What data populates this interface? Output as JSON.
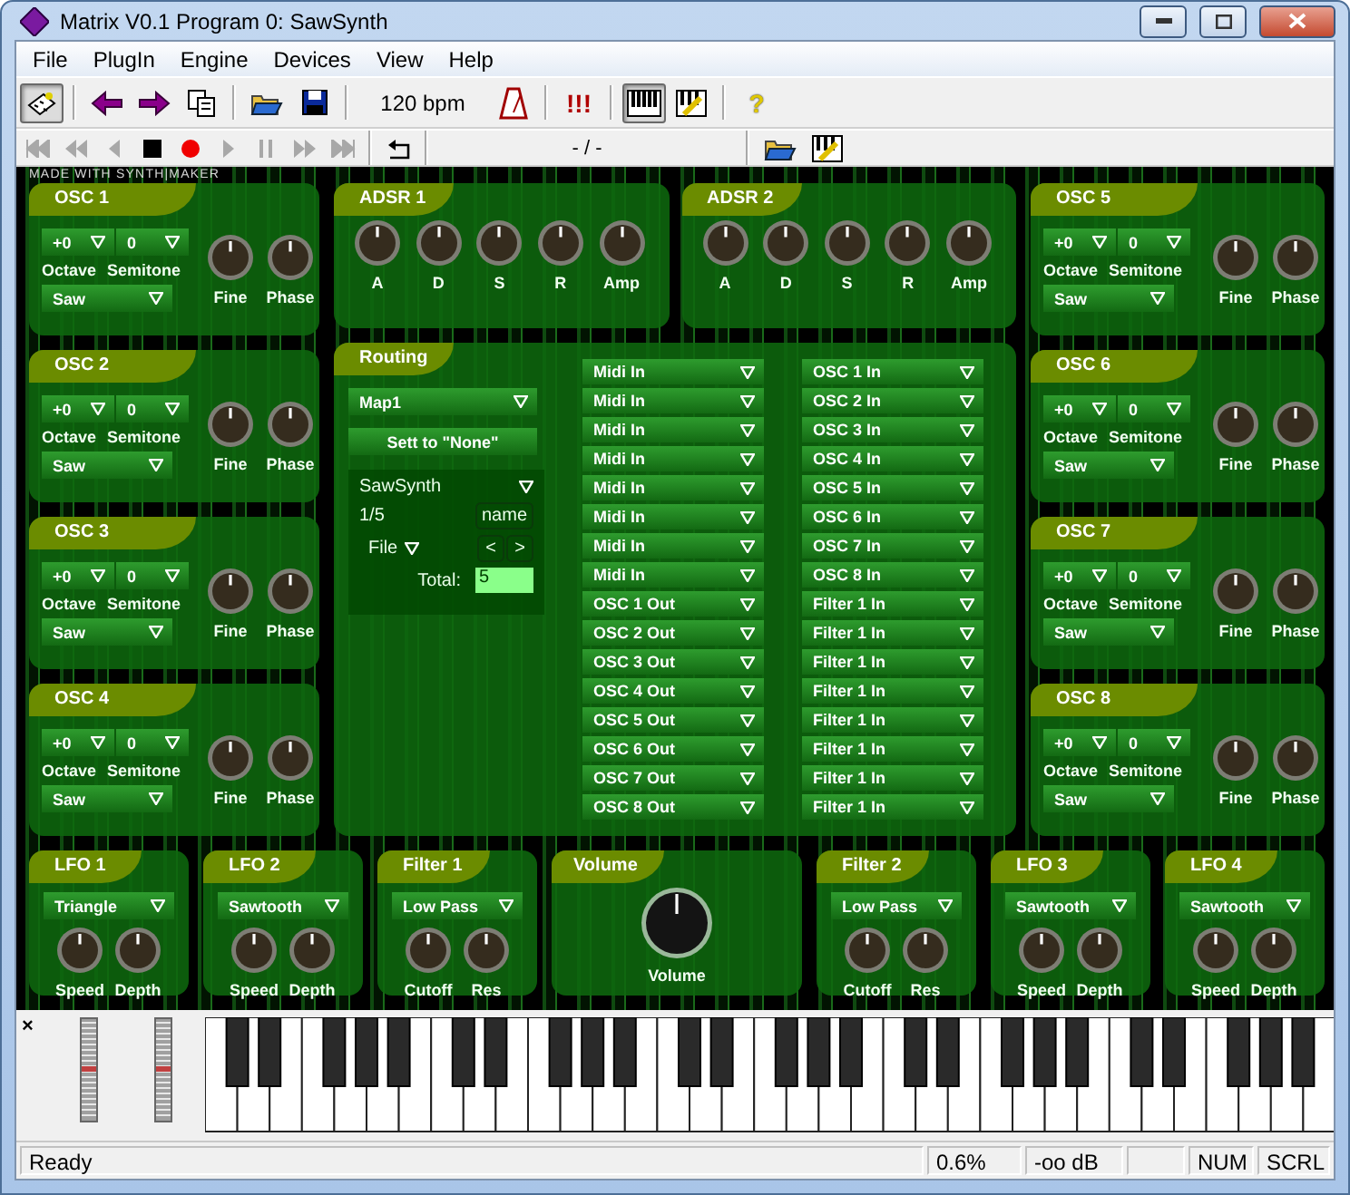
{
  "window": {
    "title": "Matrix V0.1 Program 0: SawSynth"
  },
  "menu": [
    "File",
    "PlugIn",
    "Engine",
    "Devices",
    "View",
    "Help"
  ],
  "toolbar": {
    "tempo": "120 bpm",
    "buttons": [
      {
        "pressed": true
      },
      {
        "pressed": false
      },
      {
        "pressed": false
      },
      {
        "pressed": false
      },
      {
        "pressed": false
      },
      {
        "pressed": false
      },
      {
        "pressed": false
      },
      {
        "pressed": false,
        "label": "!!!"
      },
      {
        "pressed": true
      },
      {
        "pressed": false
      },
      {
        "pressed": false,
        "label": "?"
      }
    ]
  },
  "transport": {
    "position": "- / -",
    "buttons": [
      {
        "disabled": true
      },
      {
        "disabled": true
      },
      {
        "disabled": true
      },
      {
        "disabled": false
      },
      {
        "disabled": false
      },
      {
        "disabled": true
      },
      {
        "disabled": true
      },
      {
        "disabled": true
      },
      {
        "disabled": true
      },
      {
        "disabled": false
      }
    ]
  },
  "synth": {
    "credit": "MADE WITH SYNTH|MAKER",
    "left_oscs": [
      {
        "title": "OSC 1",
        "octave": "+0",
        "semitone": "0",
        "octave_label": "Octave",
        "semitone_label": "Semitone",
        "wave": "Saw",
        "knobs": [
          "Fine",
          "Phase"
        ]
      },
      {
        "title": "OSC 2",
        "octave": "+0",
        "semitone": "0",
        "octave_label": "Octave",
        "semitone_label": "Semitone",
        "wave": "Saw",
        "knobs": [
          "Fine",
          "Phase"
        ]
      },
      {
        "title": "OSC 3",
        "octave": "+0",
        "semitone": "0",
        "octave_label": "Octave",
        "semitone_label": "Semitone",
        "wave": "Saw",
        "knobs": [
          "Fine",
          "Phase"
        ]
      },
      {
        "title": "OSC 4",
        "octave": "+0",
        "semitone": "0",
        "octave_label": "Octave",
        "semitone_label": "Semitone",
        "wave": "Saw",
        "knobs": [
          "Fine",
          "Phase"
        ]
      }
    ],
    "adsr": [
      {
        "title": "ADSR 1",
        "knobs": [
          "A",
          "D",
          "S",
          "R",
          "Amp"
        ]
      },
      {
        "title": "ADSR 2",
        "knobs": [
          "A",
          "D",
          "S",
          "R",
          "Amp"
        ]
      }
    ],
    "routing": {
      "title": "Routing",
      "map": "Map1",
      "reset": "Sett to \"None\"",
      "preset": {
        "name": "SawSynth",
        "position": "1/5",
        "name_button": "name",
        "file": "File",
        "prev": "<",
        "next": ">",
        "total_label": "Total:",
        "total": "5"
      },
      "sources": [
        "Midi In",
        "Midi In",
        "Midi In",
        "Midi In",
        "Midi In",
        "Midi In",
        "Midi In",
        "Midi In",
        "OSC 1 Out",
        "OSC 2 Out",
        "OSC 3 Out",
        "OSC 4 Out",
        "OSC 5 Out",
        "OSC 6 Out",
        "OSC 7 Out",
        "OSC 8 Out"
      ],
      "destinations": [
        "OSC 1 In",
        "OSC 2 In",
        "OSC 3 In",
        "OSC 4 In",
        "OSC 5 In",
        "OSC 6 In",
        "OSC 7 In",
        "OSC 8 In",
        "Filter 1 In",
        "Filter 1 In",
        "Filter 1 In",
        "Filter 1 In",
        "Filter 1 In",
        "Filter 1 In",
        "Filter 1 In",
        "Filter 1 In"
      ]
    },
    "right_oscs": [
      {
        "title": "OSC 5",
        "octave": "+0",
        "semitone": "0",
        "octave_label": "Octave",
        "semitone_label": "Semitone",
        "wave": "Saw",
        "knobs": [
          "Fine",
          "Phase"
        ]
      },
      {
        "title": "OSC 6",
        "octave": "+0",
        "semitone": "0",
        "octave_label": "Octave",
        "semitone_label": "Semitone",
        "wave": "Saw",
        "knobs": [
          "Fine",
          "Phase"
        ]
      },
      {
        "title": "OSC 7",
        "octave": "+0",
        "semitone": "0",
        "octave_label": "Octave",
        "semitone_label": "Semitone",
        "wave": "Saw",
        "knobs": [
          "Fine",
          "Phase"
        ]
      },
      {
        "title": "OSC 8",
        "octave": "+0",
        "semitone": "0",
        "octave_label": "Octave",
        "semitone_label": "Semitone",
        "wave": "Saw",
        "knobs": [
          "Fine",
          "Phase"
        ]
      }
    ],
    "modules": [
      {
        "kind": "lfo",
        "title": "LFO 1",
        "mode": "Triangle",
        "knobs": [
          "Speed",
          "Depth"
        ]
      },
      {
        "kind": "lfo",
        "title": "LFO 2",
        "mode": "Sawtooth",
        "knobs": [
          "Speed",
          "Depth"
        ]
      },
      {
        "kind": "filter",
        "title": "Filter 1",
        "mode": "Low Pass",
        "knobs": [
          "Cutoff",
          "Res"
        ]
      },
      {
        "kind": "volume",
        "title": "Volume",
        "knobs": [
          "Volume"
        ]
      },
      {
        "kind": "filter",
        "title": "Filter 2",
        "mode": "Low Pass",
        "knobs": [
          "Cutoff",
          "Res"
        ]
      },
      {
        "kind": "lfo",
        "title": "LFO 3",
        "mode": "Sawtooth",
        "knobs": [
          "Speed",
          "Depth"
        ]
      },
      {
        "kind": "lfo",
        "title": "LFO 4",
        "mode": "Sawtooth",
        "knobs": [
          "Speed",
          "Depth"
        ]
      }
    ]
  },
  "keyboard": {
    "close": "×"
  },
  "status_bar": {
    "message": "Ready",
    "cpu": "0.6%",
    "output": "-oo dB",
    "num": "NUM",
    "scrl": "SCRL"
  }
}
